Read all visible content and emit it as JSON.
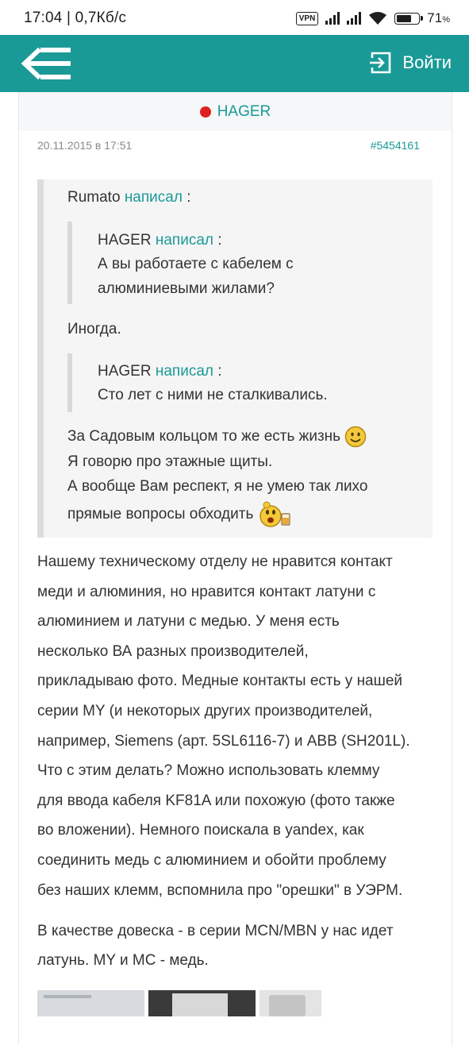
{
  "status_bar": {
    "time": "17:04 | 0,7Кб/с",
    "vpn": "VPN",
    "battery": "71",
    "battery_unit": "%",
    "battery_level": 0.71
  },
  "app_bar": {
    "back_icon": "back-menu-icon",
    "login_icon": "login-icon",
    "login_label": "Войти"
  },
  "post": {
    "author": "HAGER",
    "author_status_color": "#e02020",
    "date": "20.11.2015 в 17:51",
    "number": "#5454161",
    "quote": {
      "author": "Rumato",
      "wrote": "написал",
      "colon": ":",
      "nested1": {
        "author": "HAGER",
        "wrote": "написал",
        "colon": ":",
        "lines": [
          "А вы работаете с кабелем с",
          "алюминиевыми жилами?"
        ]
      },
      "reply1": "Иногда.",
      "nested2": {
        "author": "HAGER",
        "wrote": "написал",
        "colon": ":",
        "lines": [
          "Сто лет с ними не сталкивались."
        ]
      },
      "reply2": [
        "За Садовым кольцом то же есть жизнь",
        "Я говорю про этажные щиты.",
        "А вообще Вам респект, я не умею так лихо",
        "прямые вопросы обходить"
      ],
      "smiley1_icon": "smile-icon",
      "smiley2_icon": "beer-smiley-icon"
    },
    "paragraph1": [
      "Нашему техническому отделу не нравится контакт",
      "меди и алюминия, но нравится контакт латуни с",
      "алюминием и латуни с медью. У меня есть",
      "несколько ВА разных производителей,",
      "прикладываю фото. Медные контакты есть у нашей",
      "серии MY (и некоторых других производителей,",
      "например, Siemens (арт. 5SL6116-7) и ABB (SH201L).",
      "Что с этим делать? Можно использовать клемму",
      "для ввода кабеля KF81A или похожую (фото также",
      "во вложении). Немного поискала в yandex, как",
      "соединить медь с алюминием и обойти проблему",
      "без наших клемм, вспомнила про \"орешки\" в УЭРМ."
    ],
    "paragraph2": [
      "В качестве довеска - в серии MCN/MBN у нас идет",
      "латунь. MY и MC - медь."
    ],
    "accent_color": "#1a9a96"
  }
}
